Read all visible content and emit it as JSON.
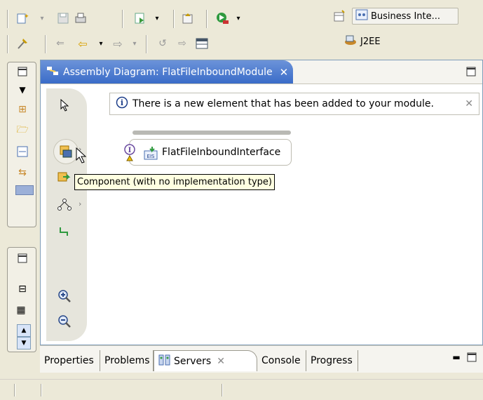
{
  "toolbar": {
    "row1": [
      "new-wizard-icon",
      "save-icon",
      "print-icon",
      "run-icon",
      "publish-icon",
      "debug-server-icon"
    ],
    "row2": [
      "pin-icon",
      "back-history-icon",
      "back-icon",
      "forward-icon",
      "refresh-icon",
      "next-icon",
      "table-icon"
    ]
  },
  "perspectives": {
    "active_label": "Business Inte...",
    "secondary_label": "J2EE"
  },
  "editor": {
    "tab_title": "Assembly Diagram: FlatFileInboundModule",
    "notification": "There is a new element that has been added to your module.",
    "node_label": "FlatFileInboundInterface",
    "node_badge": "EIS",
    "tooltip": "Component (with no implementation type)"
  },
  "bottom_tabs": [
    "Properties",
    "Problems",
    "Servers",
    "Console",
    "Progress"
  ],
  "colors": {
    "active_tab": "#3a6cc8",
    "tooltip_bg": "#ffffe1",
    "chrome": "#ece9d8"
  }
}
